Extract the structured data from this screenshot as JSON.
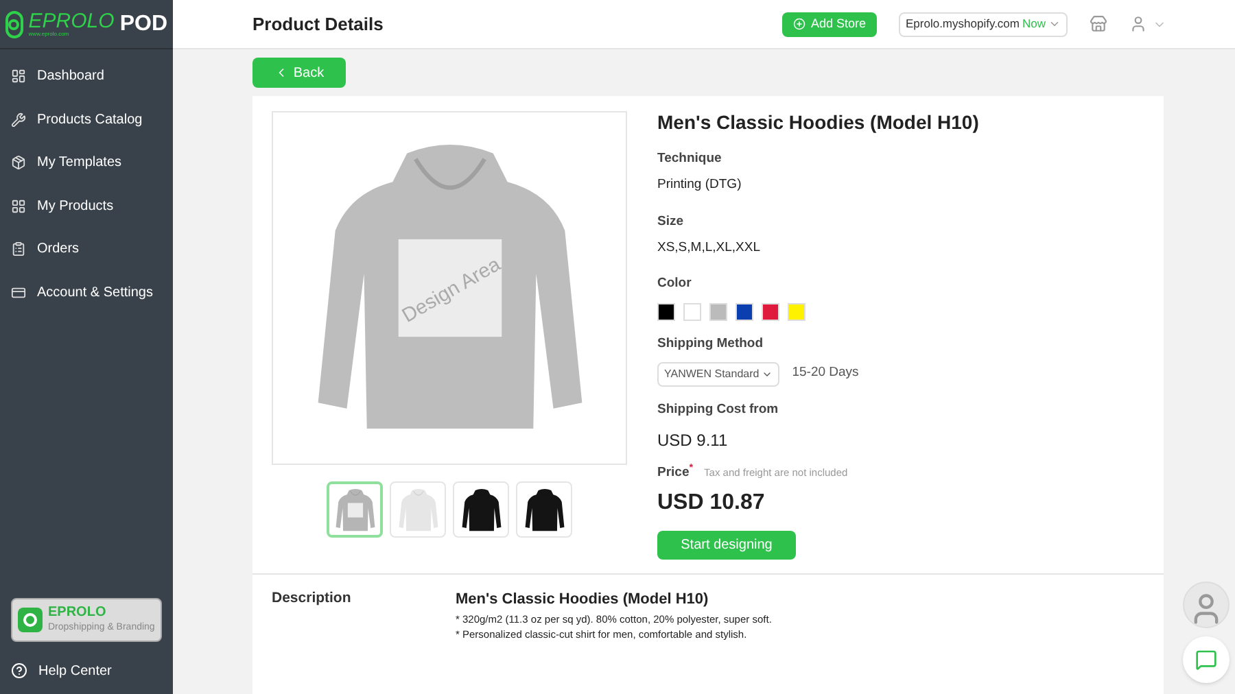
{
  "logo": {
    "brand": "EPROLO",
    "suffix": "POD",
    "tagline": "www.eprolo.com"
  },
  "sidebar": {
    "items": [
      {
        "label": "Dashboard"
      },
      {
        "label": "Products Catalog"
      },
      {
        "label": "My Templates"
      },
      {
        "label": "My Products"
      },
      {
        "label": "Orders"
      },
      {
        "label": "Account & Settings"
      }
    ],
    "promo": {
      "title": "EPROLO",
      "subtitle": "Dropshipping & Branding"
    },
    "help": "Help Center"
  },
  "header": {
    "title": "Product Details",
    "add_store": "Add Store",
    "store": "Eprolo.myshopify.com",
    "store_status": "Now"
  },
  "back": "Back",
  "gallery": {
    "watermark": "Design Area",
    "thumbnails": [
      {
        "color": "#b5b5b5",
        "selected": true
      },
      {
        "color": "#e6e6e6",
        "selected": false
      },
      {
        "color": "#141414",
        "selected": false
      },
      {
        "color": "#141414",
        "selected": false
      }
    ]
  },
  "product": {
    "title": "Men's Classic Hoodies (Model H10)",
    "technique_label": "Technique",
    "technique": "Printing (DTG)",
    "size_label": "Size",
    "sizes": "XS,S,M,L,XL,XXL",
    "color_label": "Color",
    "colors": [
      {
        "color": "#000000"
      },
      {
        "color": "#ffffff"
      },
      {
        "color": "#bbbbbb"
      },
      {
        "color": "#0b3fb0"
      },
      {
        "color": "#e01a3c"
      },
      {
        "color": "#fff200"
      }
    ],
    "shipping_label": "Shipping Method",
    "shipping_method": "YANWEN Standard",
    "shipping_days": "15-20 Days",
    "cost_label": "Shipping Cost from",
    "cost": "USD 9.11",
    "price_label": "Price",
    "price_mark": "*",
    "price_note": "Tax and freight are not included",
    "price": "USD 10.87",
    "cta": "Start designing"
  },
  "description": {
    "label": "Description",
    "title": "Men's Classic Hoodies (Model H10)",
    "lines": [
      "* 320g/m2 (11.3 oz per sq yd). 80% cotton, 20% polyester, super soft.",
      "* Personalized classic-cut shirt for men, comfortable and stylish."
    ]
  }
}
